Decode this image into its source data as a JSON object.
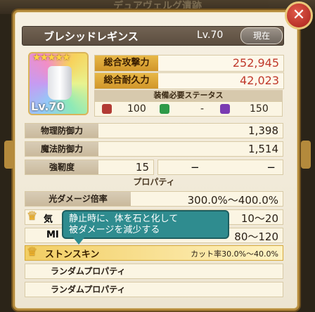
{
  "header_bg_text": "デュアヴェルグ遺跡",
  "close_symbol": "✕",
  "item": {
    "name": "ブレシッドレギンス",
    "level_label": "Lv.70",
    "current_label": "現在",
    "stars": "★★★★★",
    "portrait_level": "Lv.70"
  },
  "stats": {
    "attack_label": "総合攻撃力",
    "attack_value": "252,945",
    "durability_label": "総合耐久力",
    "durability_value": "42,023"
  },
  "requirements": {
    "title": "装備必要ステータス",
    "values": [
      "100",
      "-",
      "150"
    ]
  },
  "rows": {
    "phys_def_label": "物理防御力",
    "phys_def_value": "1,398",
    "mag_def_label": "魔法防御力",
    "mag_def_value": "1,514",
    "toughness_label": "強靭度",
    "toughness_value": "15",
    "toughness_extra1": "−",
    "toughness_extra2": "−"
  },
  "property": {
    "title": "プロパティ",
    "light_label": "光ダメージ倍率",
    "light_value": "300.0%～400.0%",
    "ki_label": "気",
    "ki_value": "10～20",
    "mp_label": "MI",
    "mp_value": "80～120"
  },
  "tooltip": {
    "line1": "静止時に、体を石と化して",
    "line2": "被ダメージを減少する"
  },
  "skill": {
    "name": "ストンスキン",
    "cut_text": "カット率30.0%～40.0%"
  },
  "random": {
    "label1": "ランダムプロパティ",
    "label2": "ランダムプロパティ"
  }
}
